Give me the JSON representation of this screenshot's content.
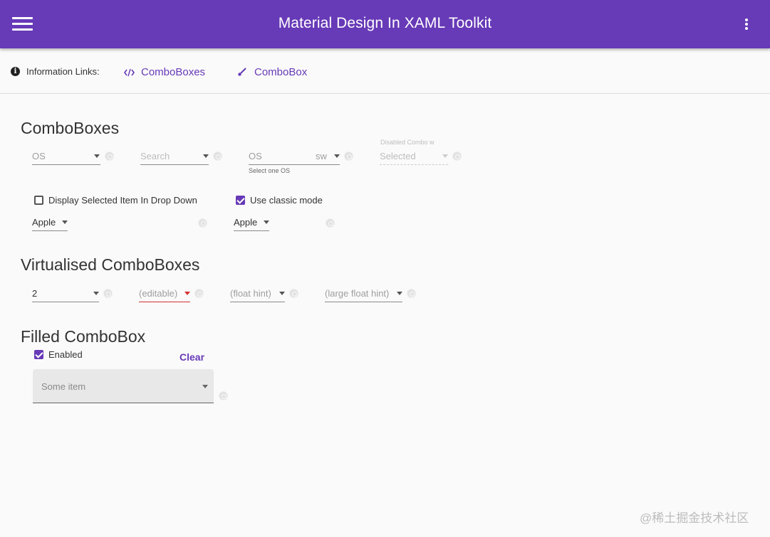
{
  "app": {
    "title": "Material Design In XAML Toolkit",
    "accent_color": "#673ab7",
    "menu_icon": "hamburger-menu-icon",
    "more_icon": "more-vertical-icon"
  },
  "info_bar": {
    "icon": "info-icon",
    "label": "Information Links:",
    "links": [
      {
        "icon": "code-icon",
        "label": "ComboBoxes"
      },
      {
        "icon": "brush-icon",
        "label": "ComboBox"
      }
    ]
  },
  "sections": {
    "comboboxes": {
      "title": "ComboBoxes",
      "os_combo": {
        "value": "OS"
      },
      "search_combo": {
        "placeholder": "Search"
      },
      "os_hint_combo": {
        "value": "OS",
        "suffix": "sw",
        "helper": "Select one OS"
      },
      "disabled_combo": {
        "hint": "Disabled Combo w",
        "value": "Selected"
      },
      "display_selected_checkbox": {
        "label": "Display Selected Item In Drop Down",
        "checked": false
      },
      "classic_mode_checkbox": {
        "label": "Use classic mode",
        "checked": true
      },
      "apple_combo_1": {
        "value": "Apple"
      },
      "apple_combo_2": {
        "value": "Apple"
      }
    },
    "virtualised": {
      "title": "Virtualised ComboBoxes",
      "number_combo": {
        "value": "2"
      },
      "editable_combo": {
        "placeholder": "(editable)",
        "status_color": "#d32f2f"
      },
      "float_hint_combo": {
        "placeholder": "(float hint)"
      },
      "large_float_hint_combo": {
        "placeholder": "(large float hint)"
      }
    },
    "filled": {
      "title": "Filled ComboBox",
      "enabled_checkbox": {
        "label": "Enabled",
        "checked": true
      },
      "clear_label": "Clear",
      "filled_combo": {
        "placeholder": "Some item"
      }
    }
  },
  "watermark": "@稀土掘金技术社区"
}
